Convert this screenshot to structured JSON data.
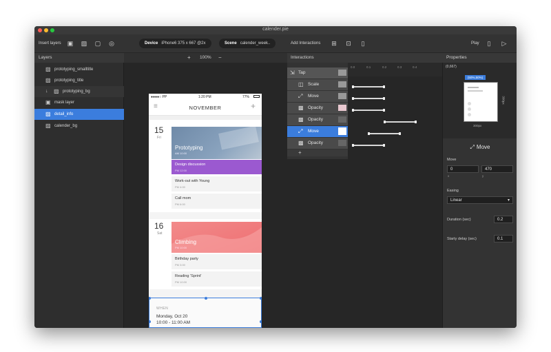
{
  "window": {
    "title": "calender.pie"
  },
  "colors": {
    "accent": "#3b7ddd",
    "purple": "#9b59d0",
    "pink": "#f07a7a"
  },
  "toolbar": {
    "insert_layers": "Insert layers",
    "device_label": "Device",
    "device_value": "iPhone6  375 x 667 @2x",
    "scene_label": "Scene",
    "scene_value": "calender_week..",
    "add_interactions": "Add Interactions",
    "play": "Play"
  },
  "layers": {
    "header": "Layers",
    "items": [
      {
        "label": "prototyping_smalltitle",
        "icon": "image-icon"
      },
      {
        "label": "prototyping_title",
        "icon": "image-icon"
      },
      {
        "label": "prototyping_bg",
        "icon": "image-icon"
      },
      {
        "label": "mask layer",
        "icon": "mask-icon"
      },
      {
        "label": "detail_info",
        "icon": "image-icon",
        "selected": true
      },
      {
        "label": "calender_bg",
        "icon": "image-icon"
      }
    ]
  },
  "canvas": {
    "zoom": "100%",
    "zoom_in": "+",
    "zoom_out": "−"
  },
  "phone": {
    "carrier": "●●●●○ PP",
    "time": "1:20 PM",
    "battery": "77%",
    "month": "NOVEMBER",
    "sections": [
      {
        "date": "15",
        "day": "Fri",
        "hero": "Prototyping",
        "hero_sub": "AM 10:00",
        "events": [
          {
            "title": "Design discussion",
            "time": "PM 12:00",
            "highlight": true
          },
          {
            "title": "Work-out with Young",
            "time": "PM 4:00"
          },
          {
            "title": "Call mom",
            "time": "PM 6:00"
          }
        ]
      },
      {
        "date": "16",
        "day": "Sat",
        "hero": "Climbing",
        "hero_sub": "PM 10:00",
        "events": [
          {
            "title": "Birthday party",
            "time": "PM 3:00"
          },
          {
            "title": "Reading 'Sprint'",
            "time": "PM 10:00"
          }
        ]
      }
    ],
    "detail": {
      "when_label": "WHEN",
      "date": "Monday, Oct 20",
      "time": "10:00 - 11:00 AM"
    }
  },
  "interactions": {
    "header": "Interactions",
    "ticks": [
      "0.0",
      "0.1",
      "0.2",
      "0.3",
      "0.4"
    ],
    "rows": [
      {
        "label": "Tap",
        "icon": "tap-icon",
        "start": 0,
        "end": 0
      },
      {
        "label": "Scale",
        "icon": "scale-icon",
        "start": 0.0,
        "end": 0.2
      },
      {
        "label": "Move",
        "icon": "move-icon",
        "start": 0.0,
        "end": 0.2
      },
      {
        "label": "Opacity",
        "icon": "opacity-icon",
        "start": 0.0,
        "end": 0.2
      },
      {
        "label": "Opacity",
        "icon": "opacity-icon",
        "start": 0.2,
        "end": 0.4
      },
      {
        "label": "Move",
        "icon": "move-icon",
        "start": 0.1,
        "end": 0.3,
        "selected": true
      },
      {
        "label": "Opacity",
        "icon": "opacity-icon",
        "start": 0.0,
        "end": 0.2
      }
    ],
    "add": "+"
  },
  "properties": {
    "header": "Properties",
    "coord": "(0,667)",
    "anchor": "(50%,50%)",
    "dim_h": "300px",
    "dim_w": "300px",
    "section_title": "Move",
    "move_label": "Move",
    "move_x": "0",
    "move_y": "470",
    "x_axis": "x",
    "y_axis": "y",
    "easing_label": "Easing",
    "easing_value": "Linear",
    "duration_label": "Duration (sec)",
    "duration_value": "0.2",
    "delay_label": "Starty delay (sec)",
    "delay_value": "0.1"
  }
}
